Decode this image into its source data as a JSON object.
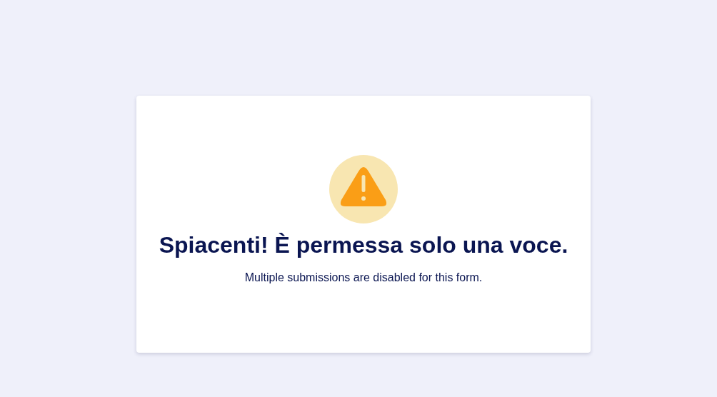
{
  "message": {
    "title": "Spiacenti! È permessa solo una voce.",
    "text": "Multiple submissions are disabled for this form."
  }
}
